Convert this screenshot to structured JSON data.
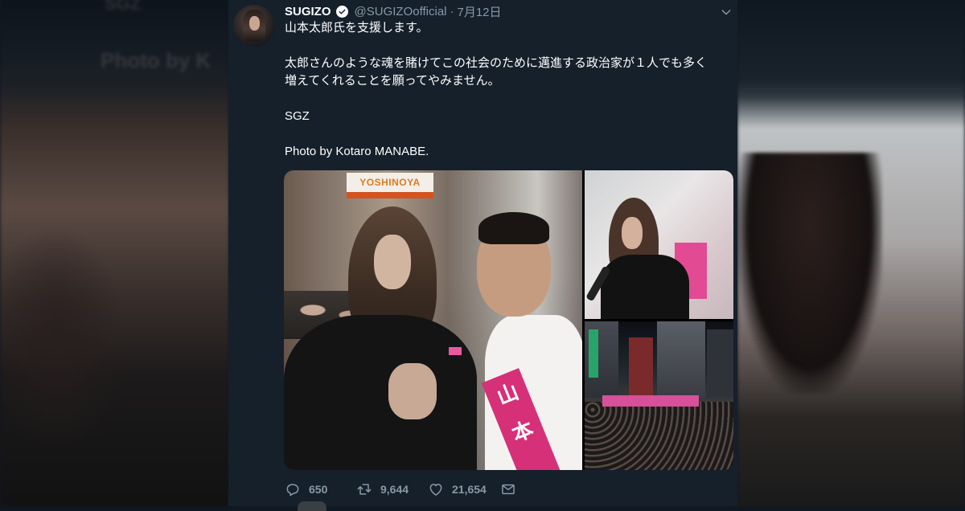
{
  "background": {
    "ghost_sgz": "SGZ",
    "ghost_text": "Photo by K"
  },
  "tweet": {
    "display_name": "SUGIZO",
    "handle": "@SUGIZOofficial",
    "separator": "·",
    "date": "7月12日",
    "body": [
      "山本太郎氏を支援します。",
      "",
      "太郎さんのような魂を賭けてこの社会のために邁進する政治家が１人でも多く",
      "増えてくれることを願ってやみません。",
      "",
      "SGZ",
      "",
      "Photo by Kotaro MANABE."
    ],
    "media_sign": "YOSHINOYA",
    "media_sash": "山本"
  },
  "actions": {
    "reply_count": "650",
    "retweet_count": "9,644",
    "like_count": "21,654"
  },
  "colors": {
    "card_bg": "#15202b",
    "secondary_text": "#8899a6",
    "verified_blue": "#1da1f2"
  },
  "icons": [
    "verified-icon",
    "chevron-down-icon",
    "reply-icon",
    "retweet-icon",
    "like-icon",
    "dm-icon"
  ]
}
